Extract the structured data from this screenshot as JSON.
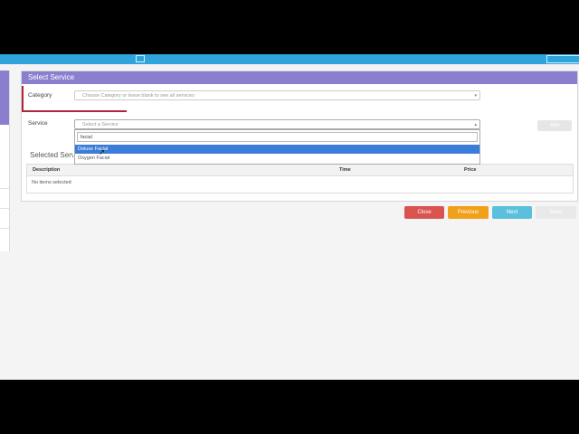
{
  "topbar": {
    "accent": "#2fa4dc"
  },
  "panel": {
    "title": "Select Service",
    "header_color": "#8a7fcf"
  },
  "category": {
    "label": "Category",
    "placeholder": "Choose Category or leave blank to see all services"
  },
  "service": {
    "label": "Service",
    "placeholder": "Select a Service",
    "add_label": "Add"
  },
  "dropdown": {
    "search_value": "facial",
    "options": [
      {
        "label": "Deluxe Facial",
        "highlighted": true
      },
      {
        "label": "Oxygen Facial",
        "highlighted": false
      }
    ]
  },
  "selected": {
    "title": "Selected Services",
    "columns": [
      "Description",
      "Time",
      "Price"
    ],
    "empty_text": "No items selected"
  },
  "actions": {
    "close": "Close",
    "previous": "Previous",
    "next": "Next",
    "save": "Save"
  },
  "colors": {
    "close": "#d9534f",
    "previous": "#f0a019",
    "next": "#5bc0de",
    "save_disabled": "#e9e9e9",
    "annotation": "#b2243c"
  }
}
